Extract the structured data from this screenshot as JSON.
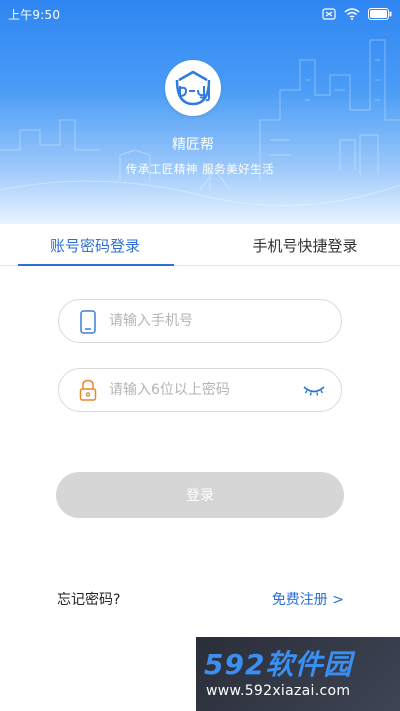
{
  "status_bar": {
    "time": "上午9:50"
  },
  "header": {
    "app_name": "精匠帮",
    "slogan": "传承工匠精神 服务美好生活"
  },
  "tabs": [
    {
      "label": "账号密码登录",
      "active": true
    },
    {
      "label": "手机号快捷登录",
      "active": false
    }
  ],
  "form": {
    "phone_placeholder": "请输入手机号",
    "password_placeholder": "请输入6位以上密码",
    "phone_value": "",
    "password_value": ""
  },
  "login_label": "登录",
  "forgot_label": "忘记密码?",
  "register_label": "免费注册 >",
  "watermark": {
    "title": "592软件园",
    "url": "www.592xiazai.com"
  },
  "colors": {
    "accent": "#2d6fd6",
    "header": "#3a8ff4",
    "button_disabled": "#d6d6d6"
  },
  "icons": [
    "sim-icon",
    "battery-icon",
    "wifi-icon",
    "logo-icon",
    "phone-icon",
    "lock-icon",
    "eye-closed-icon"
  ]
}
